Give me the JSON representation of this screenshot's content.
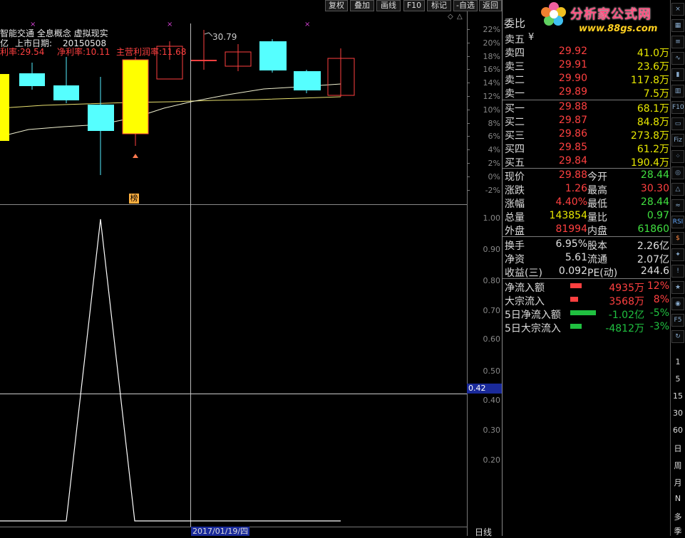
{
  "toolbar": {
    "restore": "复权",
    "overlay": "叠加",
    "draw": "画线",
    "f10": "F10",
    "mark": "标记",
    "watch": "-自选",
    "back": "返回"
  },
  "logo": {
    "brand": "分析家公式网",
    "url": "www.88gs.com"
  },
  "info": {
    "concepts": "智能交通 全息概念 虚拟现实",
    "prefix": "亿",
    "listing_label": "上市日期:",
    "listing_date": "20150508",
    "gross_margin": "毛利率:29.54",
    "net_margin": "净利率:10.11",
    "op_margin": "主营利润率:11.68"
  },
  "markers": {
    "x1": "×",
    "x2": "×",
    "x3": "×"
  },
  "price_chart": {
    "high_label": "30.79",
    "badge": "榜",
    "y_ticks": [
      "22%",
      "20%",
      "18%",
      "16%",
      "14%",
      "12%",
      "10%",
      "8%",
      "6%",
      "4%",
      "2%",
      "0%",
      "-2%"
    ]
  },
  "indicator": {
    "current": "0.42",
    "y_ticks": [
      "1.00",
      "0.90",
      "0.80",
      "0.70",
      "0.60",
      "0.50",
      "0.40",
      "0.30",
      "0.20"
    ]
  },
  "footer": {
    "date": "2017/01/19/四",
    "period": "日线"
  },
  "quote": {
    "header": "委比",
    "asks": [
      {
        "label": "卖五",
        "price": "",
        "vol": ""
      },
      {
        "label": "卖四",
        "price": "29.92",
        "vol": "41.0万"
      },
      {
        "label": "卖三",
        "price": "29.91",
        "vol": "23.6万"
      },
      {
        "label": "卖二",
        "price": "29.90",
        "vol": "117.8万"
      },
      {
        "label": "卖一",
        "price": "29.89",
        "vol": "7.5万"
      }
    ],
    "bids": [
      {
        "label": "买一",
        "price": "29.88",
        "vol": "68.1万"
      },
      {
        "label": "买二",
        "price": "29.87",
        "vol": "84.8万"
      },
      {
        "label": "买三",
        "price": "29.86",
        "vol": "273.8万"
      },
      {
        "label": "买四",
        "price": "29.85",
        "vol": "61.2万"
      },
      {
        "label": "买五",
        "price": "29.84",
        "vol": "190.4万"
      }
    ],
    "stats": {
      "now_l": "现价",
      "now_v": "29.88",
      "open_l": "今开",
      "open_v": "28.44",
      "chg_l": "涨跌",
      "chg_v": "1.26",
      "high_l": "最高",
      "high_v": "30.30",
      "pct_l": "涨幅",
      "pct_v": "4.40%",
      "low_l": "最低",
      "low_v": "28.44",
      "vol_l": "总量",
      "vol_v": "143854",
      "vr_l": "量比",
      "vr_v": "0.97",
      "out_l": "外盘",
      "out_v": "81994",
      "in_l": "内盘",
      "in_v": "61860",
      "turn_l": "换手",
      "turn_v": "6.95%",
      "cap_l": "股本",
      "cap_v": "2.26亿",
      "nav_l": "净资",
      "nav_v": "5.61",
      "float_l": "流通",
      "float_v": "2.07亿",
      "eps_l": "收益(三)",
      "eps_v": "0.092",
      "pe_l": "PE(动)",
      "pe_v": "244.6"
    },
    "flows": [
      {
        "label": "净流入额",
        "value": "4935万",
        "pct": "12%",
        "color": "#ff4040",
        "bar": 0.2
      },
      {
        "label": "大宗流入",
        "value": "3568万",
        "pct": "8%",
        "color": "#ff4040",
        "bar": 0.14
      },
      {
        "label": "5日净流入额",
        "value": "-1.02亿",
        "pct": "-5%",
        "color": "#20c040",
        "bar": 0.45
      },
      {
        "label": "5日大宗流入",
        "value": "-4812万",
        "pct": "-3%",
        "color": "#20c040",
        "bar": 0.2
      }
    ]
  },
  "sidebar_periods": [
    "1",
    "5",
    "15",
    "30",
    "60",
    "日",
    "周",
    "月",
    "N",
    "多",
    "季"
  ],
  "sidebar_icons": [
    "F10",
    "Fiz",
    "RSI",
    "F5"
  ]
}
